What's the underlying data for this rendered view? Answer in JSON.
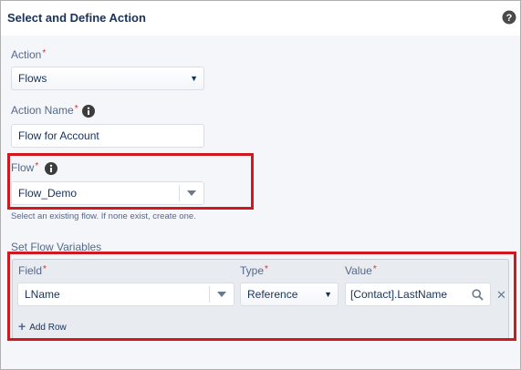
{
  "header": {
    "title": "Select and Define Action"
  },
  "action": {
    "label": "Action",
    "required_mark": "*",
    "value": "Flows"
  },
  "action_name": {
    "label": "Action Name",
    "required_mark": "*",
    "value": "Flow for Account"
  },
  "flow": {
    "label": "Flow",
    "required_mark": "*",
    "value": "Flow_Demo",
    "hint": "Select an existing flow. If none exist, create one."
  },
  "flow_variables": {
    "section_label": "Set Flow Variables",
    "columns": {
      "field": "Field",
      "type": "Type",
      "value": "Value",
      "required_mark": "*"
    },
    "rows": [
      {
        "field": "LName",
        "type": "Reference",
        "value": "[Contact].LastName"
      }
    ],
    "add_row_label": "Add Row"
  },
  "icons": {
    "help": "question-circle-icon",
    "info": "info-icon",
    "search": "search-icon",
    "remove": "close-icon",
    "add": "plus-icon"
  },
  "colors": {
    "highlight_red": "#d1181f",
    "text_dark": "#16325c",
    "label_gray": "#54698d"
  }
}
